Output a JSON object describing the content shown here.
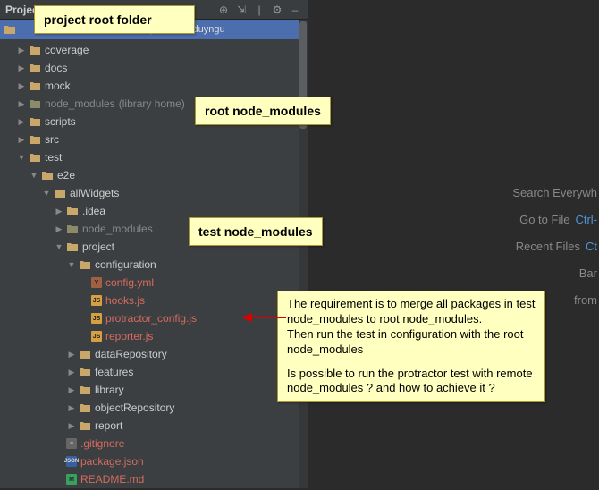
{
  "panel": {
    "title": "Project"
  },
  "crumb": {
    "path": "(C:\\Users\\duyngu"
  },
  "tree": {
    "coverage": "coverage",
    "docs": "docs",
    "mock": "mock",
    "node_modules": "node_modules",
    "node_modules_hint": "(library home)",
    "scripts": "scripts",
    "src": "src",
    "test": "test",
    "e2e": "e2e",
    "allWidgets": "allWidgets",
    "idea": ".idea",
    "nm2": "node_modules",
    "project": "project",
    "configuration": "configuration",
    "configyml": "config.yml",
    "hooksjs": "hooks.js",
    "protractor": "protractor_config.js",
    "reporterjs": "reporter.js",
    "dataRepository": "dataRepository",
    "features": "features",
    "library": "library",
    "objectRepository": "objectRepository",
    "report": "report",
    "gitignore": ".gitignore",
    "packagejson": "package.json",
    "readme": "README.md"
  },
  "shortcuts": {
    "search": "Search Everywh",
    "gotofile": "Go to File",
    "gotofile_key": "Ctrl-",
    "recent": "Recent Files",
    "recent_key": "Ct",
    "bar": "Bar",
    "from": "from"
  },
  "callouts": {
    "root": "project root folder",
    "root_nm": "root node_modules",
    "test_nm": "test node_modules",
    "req_l1": "The requirement is to merge all packages in test node_modules to root node_modules.",
    "req_l2": "Then run the test in configuration with the root node_modules",
    "req_l3": "Is possible to run the protractor test with remote node_modules ? and how to achieve it ?"
  }
}
